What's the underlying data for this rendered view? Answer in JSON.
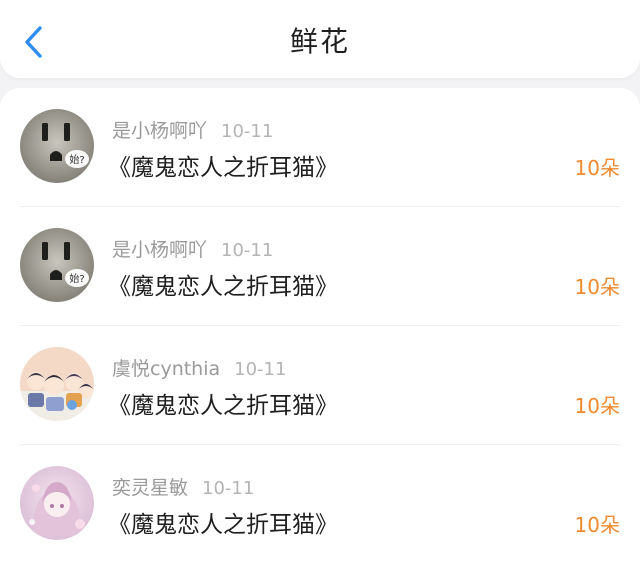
{
  "header": {
    "title": "鲜花",
    "back_icon": "chevron-left-icon",
    "accent_color": "#2d8cf0"
  },
  "colors": {
    "amount": "#ef8a2f",
    "name": "#9a9a9a"
  },
  "records": [
    {
      "name": "是小杨啊吖",
      "date": "10-11",
      "work": "《魔鬼恋人之折耳猫》",
      "amount": "10朵",
      "avatar": "outlet-avatar",
      "avatar_text": "始?"
    },
    {
      "name": "是小杨啊吖",
      "date": "10-11",
      "work": "《魔鬼恋人之折耳猫》",
      "amount": "10朵",
      "avatar": "outlet-avatar",
      "avatar_text": "始?"
    },
    {
      "name": "虞悦cynthia",
      "date": "10-11",
      "work": "《魔鬼恋人之折耳猫》",
      "amount": "10朵",
      "avatar": "cartoon-group-avatar"
    },
    {
      "name": "奕灵星敏",
      "date": "10-11",
      "work": "《魔鬼恋人之折耳猫》",
      "amount": "10朵",
      "avatar": "anime-girl-avatar"
    }
  ]
}
